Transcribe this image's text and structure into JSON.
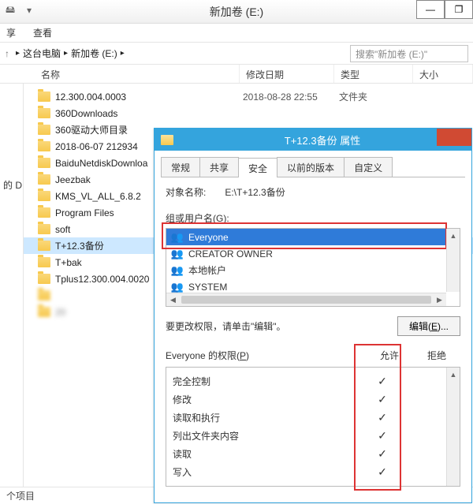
{
  "window": {
    "title": "新加卷 (E:)"
  },
  "ribbon": {
    "share": "享",
    "view": "查看"
  },
  "breadcrumb": {
    "pc": "这台电脑",
    "drive": "新加卷 (E:)"
  },
  "search": {
    "placeholder": "搜索\"新加卷 (E:)\""
  },
  "columns": {
    "name": "名称",
    "date": "修改日期",
    "type": "类型",
    "size": "大小"
  },
  "leftpane": {
    "d": "的 D"
  },
  "files": [
    {
      "name": "12.300.004.0003",
      "date": "2018-08-28 22:55",
      "type": "文件夹"
    },
    {
      "name": "360Downloads"
    },
    {
      "name": "360驱动大师目录"
    },
    {
      "name": "2018-06-07 212934"
    },
    {
      "name": "BaiduNetdiskDownloa"
    },
    {
      "name": "Jeezbak"
    },
    {
      "name": "KMS_VL_ALL_6.8.2"
    },
    {
      "name": "Program Files"
    },
    {
      "name": "soft"
    },
    {
      "name": "T+12.3备份",
      "selected": true
    },
    {
      "name": "T+bak"
    },
    {
      "name": "Tplus12.300.004.0020"
    },
    {
      "name": "",
      "blur": true
    },
    {
      "name": "20",
      "blur": true
    }
  ],
  "status": {
    "text": "个项目"
  },
  "prop": {
    "title": "T+12.3备份 属性",
    "tabs": {
      "general": "常规",
      "share": "共享",
      "security": "安全",
      "prev": "以前的版本",
      "custom": "自定义"
    },
    "object_label": "对象名称:",
    "object_value": "E:\\T+12.3备份",
    "group_label_pre": "组或用户名(",
    "group_label_u": "G",
    "group_label_post": "):",
    "groups": [
      {
        "name": "Everyone",
        "selected": true
      },
      {
        "name": "CREATOR OWNER"
      },
      {
        "name": "本地帐户"
      },
      {
        "name": "SYSTEM"
      }
    ],
    "edit_text": "要更改权限，请单击\"编辑\"。",
    "edit_btn_pre": "编辑(",
    "edit_btn_u": "E",
    "edit_btn_post": ")...",
    "perm_label_pre": "Everyone 的权限(",
    "perm_label_u": "P",
    "perm_label_post": ")",
    "allow": "允许",
    "deny": "拒绝",
    "perms": [
      {
        "name": "完全控制",
        "allow": "✓"
      },
      {
        "name": "修改",
        "allow": "✓"
      },
      {
        "name": "读取和执行",
        "allow": "✓"
      },
      {
        "name": "列出文件夹内容",
        "allow": "✓"
      },
      {
        "name": "读取",
        "allow": "✓"
      },
      {
        "name": "写入",
        "allow": "✓"
      }
    ]
  }
}
